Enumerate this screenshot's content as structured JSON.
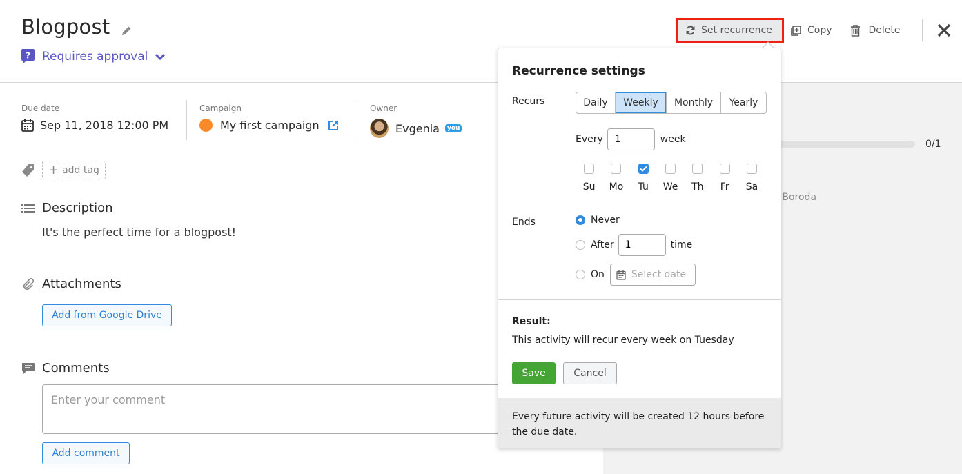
{
  "header": {
    "title": "Blogpost",
    "status_label": "Requires approval"
  },
  "toolbar": {
    "set_recurrence_label": "Set recurrence",
    "copy_label": "Copy",
    "delete_label": "Delete"
  },
  "meta": {
    "due_date_label": "Due date",
    "due_date_value": "Sep 11, 2018 12:00 PM",
    "campaign_label": "Campaign",
    "campaign_value": "My first campaign",
    "campaign_color": "#f88a2a",
    "owner_label": "Owner",
    "owner_value": "Evgenia",
    "owner_badge": "you"
  },
  "tags": {
    "add_tag_label": "add tag"
  },
  "description": {
    "heading": "Description",
    "text": "It's the perfect time for a blogpost!"
  },
  "attachments": {
    "heading": "Attachments",
    "button_label": "Add from Google Drive"
  },
  "comments": {
    "heading": "Comments",
    "placeholder": "Enter your comment",
    "value": "",
    "button_label": "Add comment"
  },
  "right_panel": {
    "progress_count": "0/1",
    "progress_fraction": 0,
    "person_name_partial": "olai Boroda"
  },
  "recurrence": {
    "title": "Recurrence settings",
    "recurs_label": "Recurs",
    "options": [
      {
        "label": "Daily",
        "active": false
      },
      {
        "label": "Weekly",
        "active": true
      },
      {
        "label": "Monthly",
        "active": false
      },
      {
        "label": "Yearly",
        "active": false
      }
    ],
    "every_label": "Every",
    "every_value": "1",
    "every_unit": "week",
    "days": [
      {
        "label": "Su",
        "checked": false
      },
      {
        "label": "Mo",
        "checked": false
      },
      {
        "label": "Tu",
        "checked": true
      },
      {
        "label": "We",
        "checked": false
      },
      {
        "label": "Th",
        "checked": false
      },
      {
        "label": "Fr",
        "checked": false
      },
      {
        "label": "Sa",
        "checked": false
      }
    ],
    "ends_label": "Ends",
    "ends_options": {
      "never_label": "Never",
      "after_label": "After",
      "after_value": "1",
      "after_unit": "time",
      "on_label": "On",
      "on_placeholder": "Select date",
      "selected": "never"
    },
    "result_heading": "Result:",
    "result_text": "This activity will recur every week on Tuesday",
    "save_label": "Save",
    "cancel_label": "Cancel",
    "footer_note": "Every future activity will be created 12 hours before the due date."
  },
  "colors": {
    "accent_blue": "#2f8ee0",
    "approval_purple": "#5a57c4",
    "save_green": "#45a534",
    "highlight_red": "#f02010"
  }
}
